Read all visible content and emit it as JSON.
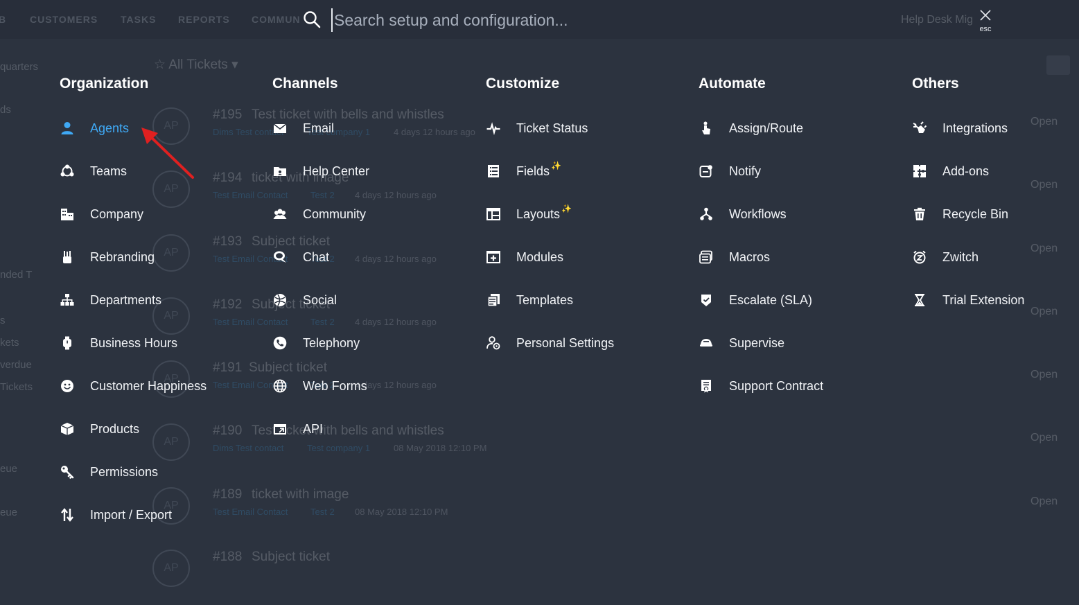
{
  "search": {
    "placeholder": "Search setup and configuration...",
    "close_label": "esc"
  },
  "background": {
    "nav": [
      "B",
      "CUSTOMERS",
      "TASKS",
      "REPORTS",
      "COMMUN"
    ],
    "helpdesk": "Help Desk Mig",
    "view_title": "All Tickets",
    "sidebar": [
      "quarters",
      "ds",
      "nded T",
      "s",
      "kets",
      "verdue",
      "Tickets",
      "eue",
      "eue"
    ],
    "tickets": [
      {
        "num": "#195",
        "subject": "Test ticket with bells and whistles",
        "contact": "Dims Test contact",
        "company": "Test company 1",
        "time": "4 days 12 hours ago",
        "status": "Open"
      },
      {
        "num": "#194",
        "subject": "ticket with image",
        "contact": "Test Email Contact",
        "company": "Test 2",
        "time": "4 days 12 hours ago",
        "status": "Open"
      },
      {
        "num": "#193",
        "subject": "Subject ticket",
        "contact": "Test Email Contact",
        "company": "Test 2",
        "time": "4 days 12 hours ago",
        "status": "Open"
      },
      {
        "num": "#192",
        "subject": "Subject ticket",
        "contact": "Test Email Contact",
        "company": "Test 2",
        "time": "4 days 12 hours ago",
        "status": "Open"
      },
      {
        "num": "#191",
        "subject": "Subject ticket",
        "contact": "Test Email Contact",
        "company": "Test 2",
        "time": "4 days 12 hours ago",
        "status": "Open"
      },
      {
        "num": "#190",
        "subject": "Test ticket with bells and whistles",
        "contact": "Dims Test contact",
        "company": "Test company 1",
        "time": "08 May 2018 12:10 PM",
        "status": "Open"
      },
      {
        "num": "#189",
        "subject": "ticket with image",
        "contact": "Test Email Contact",
        "company": "Test 2",
        "time": "08 May 2018 12:10 PM",
        "status": "Open"
      },
      {
        "num": "#188",
        "subject": "Subject ticket",
        "contact": "",
        "company": "",
        "time": "",
        "status": ""
      }
    ],
    "avatar_initials": "AP"
  },
  "menu": {
    "organization": {
      "title": "Organization",
      "items": [
        {
          "label": "Agents",
          "icon": "person-icon"
        },
        {
          "label": "Teams",
          "icon": "team-icon"
        },
        {
          "label": "Company",
          "icon": "building-icon"
        },
        {
          "label": "Rebranding",
          "icon": "brush-icon"
        },
        {
          "label": "Departments",
          "icon": "org-chart-icon"
        },
        {
          "label": "Business Hours",
          "icon": "watch-icon"
        },
        {
          "label": "Customer Happiness",
          "icon": "smiley-icon"
        },
        {
          "label": "Products",
          "icon": "box-icon"
        },
        {
          "label": "Permissions",
          "icon": "key-icon"
        },
        {
          "label": "Import / Export",
          "icon": "import-export-icon"
        }
      ]
    },
    "channels": {
      "title": "Channels",
      "items": [
        {
          "label": "Email",
          "icon": "envelope-icon"
        },
        {
          "label": "Help Center",
          "icon": "help-center-icon"
        },
        {
          "label": "Community",
          "icon": "community-icon"
        },
        {
          "label": "Chat",
          "icon": "chat-icon"
        },
        {
          "label": "Social",
          "icon": "social-icon"
        },
        {
          "label": "Telephony",
          "icon": "phone-icon"
        },
        {
          "label": "Web Forms",
          "icon": "globe-icon"
        },
        {
          "label": "API",
          "icon": "api-icon"
        }
      ]
    },
    "customize": {
      "title": "Customize",
      "items": [
        {
          "label": "Ticket Status",
          "icon": "pulse-icon"
        },
        {
          "label": "Fields",
          "icon": "fields-icon",
          "sparkle": "✨"
        },
        {
          "label": "Layouts",
          "icon": "layout-icon",
          "sparkle": "✨"
        },
        {
          "label": "Modules",
          "icon": "modules-icon"
        },
        {
          "label": "Templates",
          "icon": "templates-icon"
        },
        {
          "label": "Personal Settings",
          "icon": "personal-settings-icon"
        }
      ]
    },
    "automate": {
      "title": "Automate",
      "items": [
        {
          "label": "Assign/Route",
          "icon": "pointer-icon"
        },
        {
          "label": "Notify",
          "icon": "notify-icon"
        },
        {
          "label": "Workflows",
          "icon": "workflow-icon"
        },
        {
          "label": "Macros",
          "icon": "macros-icon"
        },
        {
          "label": "Escalate (SLA)",
          "icon": "shield-icon"
        },
        {
          "label": "Supervise",
          "icon": "supervise-icon"
        },
        {
          "label": "Support Contract",
          "icon": "contract-icon"
        }
      ]
    },
    "others": {
      "title": "Others",
      "items": [
        {
          "label": "Integrations",
          "icon": "plug-icon"
        },
        {
          "label": "Add-ons",
          "icon": "puzzle-icon"
        },
        {
          "label": "Recycle Bin",
          "icon": "trash-icon"
        },
        {
          "label": "Zwitch",
          "icon": "alarm-z-icon"
        },
        {
          "label": "Trial Extension",
          "icon": "hourglass-icon"
        }
      ]
    }
  },
  "colors": {
    "overlay": "#2c333f",
    "active_link": "#3fa9f5",
    "annotation_arrow": "#e02020",
    "sparkle": "#f7b733"
  }
}
